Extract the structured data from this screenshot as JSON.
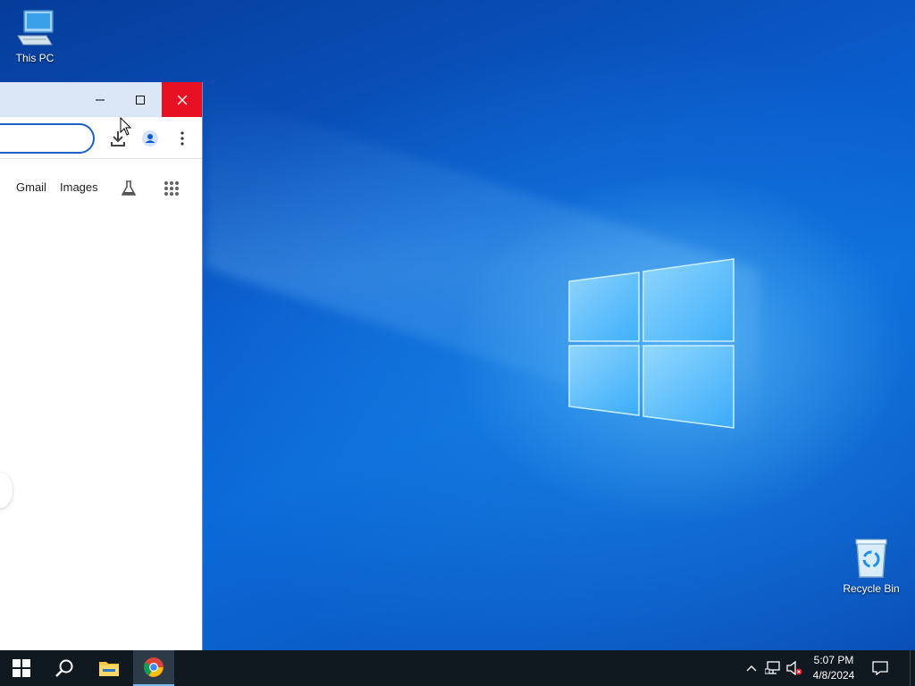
{
  "desktop": {
    "icons": [
      {
        "label": "This PC"
      },
      {
        "label": "Recycle Bin"
      }
    ]
  },
  "browser": {
    "titlebar": {
      "minimize_glyph": "—",
      "maximize_glyph": "☐",
      "close_glyph": "✕"
    },
    "toolbar": {
      "download_icon": "download-icon",
      "profile_icon": "profile-icon",
      "menu_icon": "kebab-menu-icon"
    },
    "page": {
      "links": [
        {
          "label": "Gmail"
        },
        {
          "label": "Images"
        }
      ],
      "labs_icon": "labs-flask-icon",
      "apps_icon": "apps-grid-icon"
    }
  },
  "taskbar": {
    "items": [
      "start-icon",
      "search-icon",
      "file-explorer-icon",
      "chrome-icon"
    ],
    "tray": {
      "time": "5:07 PM",
      "date": "4/8/2024"
    }
  },
  "colors": {
    "accent": "#1a61c6",
    "close_red": "#e81123",
    "taskbar": "#101820"
  }
}
